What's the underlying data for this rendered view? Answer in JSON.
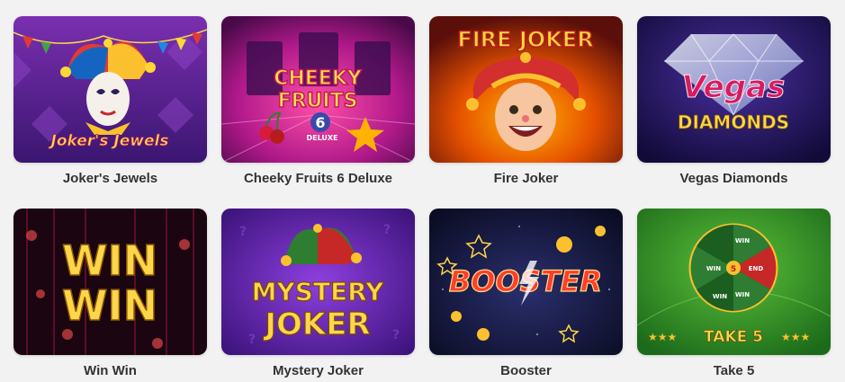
{
  "games": [
    {
      "title": "Joker's Jewels",
      "logo": "Joker's Jewels"
    },
    {
      "title": "Cheeky Fruits 6 Deluxe",
      "logo_line1": "CHEEKY",
      "logo_line2": "FRUITS",
      "logo_num": "6",
      "logo_sub": "DELUXE"
    },
    {
      "title": "Fire Joker",
      "logo": "FIRE JOKER"
    },
    {
      "title": "Vegas Diamonds",
      "logo_line1": "Vegas",
      "logo_line2": "DIAMONDS"
    },
    {
      "title": "Win Win",
      "logo_line1": "WIN",
      "logo_line2": "WIN"
    },
    {
      "title": "Mystery Joker",
      "logo_line1": "MYSTERY",
      "logo_line2": "JOKER"
    },
    {
      "title": "Booster",
      "logo": "BOOSTER"
    },
    {
      "title": "Take 5",
      "logo": "TAKE 5",
      "wheel_labels": [
        "WIN",
        "WIN",
        "WIN",
        "WIN",
        "5",
        "END"
      ]
    }
  ]
}
